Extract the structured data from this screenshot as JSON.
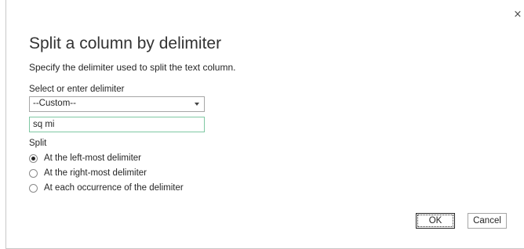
{
  "dialog": {
    "close_glyph": "×",
    "title": "Split a column by delimiter",
    "subtitle": "Specify the delimiter used to split the text column.",
    "delimiter_label": "Select or enter delimiter",
    "delimiter_selected": "--Custom--",
    "custom_value": "sq mi",
    "split_label": "Split",
    "options": [
      {
        "label": "At the left-most delimiter",
        "checked": true
      },
      {
        "label": "At the right-most delimiter",
        "checked": false
      },
      {
        "label": "At each occurrence of the delimiter",
        "checked": false
      }
    ],
    "ok_label": "OK",
    "cancel_label": "Cancel"
  }
}
